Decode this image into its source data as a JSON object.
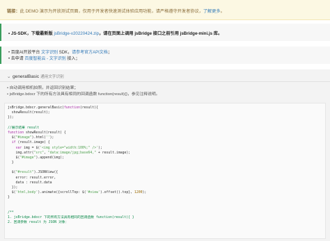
{
  "notice": {
    "label": "链接：",
    "text": "此 DEMO 演示为开放测试页面，仅用于开发者快速测试体验应用功能，请严格遵守开发者协议，",
    "link": "了解更多",
    "end": "。"
  },
  "tip1": {
    "bullet": "• JS-SDK，下载最新版",
    "link": "jsBridge-v20220424.zip",
    "rest": "，请在页面上调用 jsBridge 接口之前引用 jsBridge-mini.js 库。"
  },
  "tip2": {
    "line1_pre": "• 百度AI开放平台",
    "line1_link1": "文字识别",
    "line1_mid": "SDK，",
    "line1_link2": "请参考官方API文档",
    "line1_end": "；",
    "line2_pre": "• 去申请",
    "line2_link": "百度智能云 - 文字识别",
    "line2_end": "接入；"
  },
  "panel": {
    "title": "generalBasic",
    "subtitle": "通用文字识别",
    "desc1": "• 自动调用相机拍照，并返回识别结果；",
    "desc2": "• jsBridge.bdocr 下的所有方法具有相同的回调函数 function(result){}，参见注释说明。"
  },
  "code_lines": [
    "jsBridge.bdocr.generalBasic(function(result){",
    "  showResult(result);",
    "});",
    "",
    "//展示结果 result",
    "function showResult(result) {",
    "  $(\"#image\").html('');",
    "  if (result.image) {",
    "    var img = $('<img style=\"width:100%;\" />');",
    "    img.attr(\"src\", \"data:image/jpg;base64,\" + result.image);",
    "    $(\"#image\").append(img);",
    "  }",
    "",
    "  $(\"#result\").JSONView({",
    "    error: result.error,",
    "    data : result.data",
    "  });",
    "  $('html,body').animate({scrollTop: $('#view').offset().top}, 1200);",
    "}",
    "",
    "",
    "/**",
    "1. jsBridge.bdocr 下的所有方法具有相同的回调函数 function(result){ }",
    "2. 回调参数 result 为 JSON 对象："
  ]
}
